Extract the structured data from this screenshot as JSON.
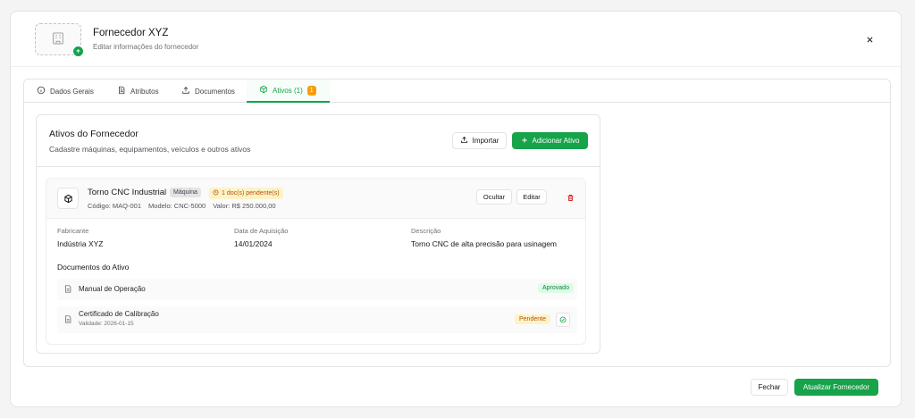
{
  "header": {
    "title": "Fornecedor XYZ",
    "subtitle": "Editar informações do fornecedor",
    "logo_icon": "building-icon",
    "badge_icon": "upload-icon",
    "close_icon": "close-icon"
  },
  "tabs": [
    {
      "label": "Dados Gerais",
      "icon": "info-icon"
    },
    {
      "label": "Atributos",
      "icon": "document-icon"
    },
    {
      "label": "Documentos",
      "icon": "upload-icon"
    },
    {
      "label": "Ativos (1)",
      "icon": "cube-icon",
      "count": "1",
      "active": true
    }
  ],
  "assets_card": {
    "title": "Ativos do Fornecedor",
    "subtitle": "Cadastre máquinas, equipamentos, veículos e outros ativos",
    "import_label": "Importar",
    "add_label": "Adicionar Ativo"
  },
  "asset": {
    "name": "Torno CNC Industrial",
    "type_tag": "Máquina",
    "pending_tag": "1 doc(s) pendente(s)",
    "code": "Código: MAQ-001",
    "model": "Modelo: CNC-5000",
    "value": "Valor: R$ 250.000,00",
    "hide_label": "Ocultar",
    "edit_label": "Editar",
    "fields": [
      {
        "label": "Fabricante",
        "value": "Indústria XYZ"
      },
      {
        "label": "Data de Aquisição",
        "value": "14/01/2024"
      },
      {
        "label": "Descrição",
        "value": "Torno CNC de alta precisão para usinagem"
      }
    ],
    "docs_title": "Documentos do Ativo",
    "documents": [
      {
        "name": "Manual de Operação",
        "status": "Aprovado"
      },
      {
        "name": "Certificado de Calibração",
        "sub": "Validade: 2026-01-15",
        "status": "Pendente"
      }
    ]
  },
  "footer": {
    "close_label": "Fechar",
    "submit_label": "Atualizar Fornecedor"
  },
  "colors": {
    "accent": "#16a34a",
    "warning": "#f59e0b",
    "danger": "#dc2626"
  }
}
